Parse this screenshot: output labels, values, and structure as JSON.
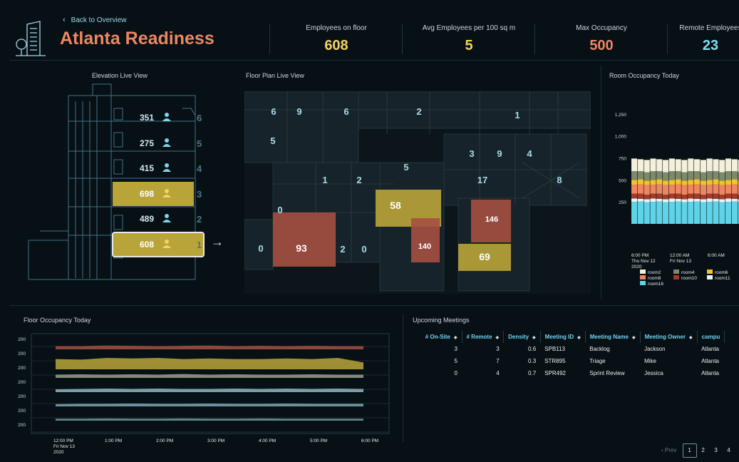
{
  "header": {
    "back_label": "Back to Overview",
    "title": "Atlanta Readiness",
    "kpis": [
      {
        "label": "Employees on floor",
        "value": "608",
        "color": "#f4d35e"
      },
      {
        "label": "Avg Employees per 100 sq m",
        "value": "5",
        "color": "#f4d35e"
      },
      {
        "label": "Max Occupancy",
        "value": "500",
        "color": "#ef8661"
      },
      {
        "label": "Remote Employees",
        "value": "23",
        "color": "#7fe0f0"
      }
    ]
  },
  "elevation": {
    "title": "Elevation Live View",
    "floors": [
      {
        "floor": "6",
        "count": "351",
        "highlight": false
      },
      {
        "floor": "5",
        "count": "275",
        "highlight": false
      },
      {
        "floor": "4",
        "count": "415",
        "highlight": false
      },
      {
        "floor": "3",
        "count": "698",
        "highlight": true
      },
      {
        "floor": "2",
        "count": "489",
        "highlight": false
      },
      {
        "floor": "1",
        "count": "608",
        "highlight": true,
        "selected": true
      }
    ]
  },
  "floorplan": {
    "title": "Floor Plan Live View",
    "rooms": [
      "6",
      "9",
      "6",
      "2",
      "1",
      "5",
      "3",
      "9",
      "4",
      "5",
      "1",
      "2",
      "17",
      "8",
      "0",
      "58",
      "146",
      "0",
      "93",
      "2",
      "0",
      "140",
      "69"
    ]
  },
  "room_occupancy": {
    "title": "Room Occupancy Today",
    "legend": [
      {
        "name": "room2",
        "color": "#f4f0dc"
      },
      {
        "name": "room4",
        "color": "#7c8a6a"
      },
      {
        "name": "room6",
        "color": "#f2c230"
      },
      {
        "name": "room8",
        "color": "#ef8661"
      },
      {
        "name": "room10",
        "color": "#a33b2a"
      },
      {
        "name": "room11",
        "color": "#e6f6f8"
      },
      {
        "name": "room16",
        "color": "#5fd3e8"
      }
    ],
    "x_ticks": [
      {
        "l1": "6:00 PM",
        "l2": "Thu Nov 12",
        "l3": "2020"
      },
      {
        "l1": "12:00 AM",
        "l2": "Fri Nov 13",
        "l3": ""
      },
      {
        "l1": "6:00 AM",
        "l2": "",
        "l3": ""
      }
    ]
  },
  "chart_data": [
    {
      "type": "bar",
      "title": "Room Occupancy Today",
      "ylim": [
        0,
        1250
      ],
      "y_ticks": [
        "250",
        "500",
        "750",
        "1,000",
        "1,250"
      ],
      "stacked": true,
      "bars": 18,
      "series": [
        {
          "name": "room16",
          "values": 250
        },
        {
          "name": "room11",
          "values": 35
        },
        {
          "name": "room10",
          "values": 55
        },
        {
          "name": "room8",
          "values": 105
        },
        {
          "name": "room6",
          "values": 55
        },
        {
          "name": "room4",
          "values": 95
        },
        {
          "name": "room2",
          "values": 140
        }
      ]
    },
    {
      "type": "area",
      "title": "Floor Occupancy Today",
      "y_ticks": [
        "200",
        "200",
        "200",
        "200",
        "200",
        "200",
        "200"
      ],
      "x_ticks": [
        {
          "l1": "12:00 PM",
          "l2": "Fri Nov 13",
          "l3": "2020"
        },
        {
          "l1": "1:00 PM",
          "l2": "",
          "l3": ""
        },
        {
          "l1": "2:00 PM",
          "l2": "",
          "l3": ""
        },
        {
          "l1": "3:00 PM",
          "l2": "",
          "l3": ""
        },
        {
          "l1": "4:00 PM",
          "l2": "",
          "l3": ""
        },
        {
          "l1": "5:00 PM",
          "l2": "",
          "l3": ""
        },
        {
          "l1": "6:00 PM",
          "l2": "",
          "l3": ""
        }
      ],
      "series": [
        {
          "color": "#a55040",
          "values": [
            0.5,
            0.5,
            0.6,
            0.55,
            0.5,
            0.55,
            0.6,
            0.5,
            0.55,
            0.5,
            0.55,
            0.5,
            0.5
          ]
        },
        {
          "color": "#b9a43a",
          "values": [
            0.9,
            0.85,
            1.0,
            0.95,
            1.0,
            0.9,
            0.95,
            0.9,
            0.9,
            0.95,
            0.9,
            1.0,
            0.6
          ]
        },
        {
          "color": "#9a9d8a",
          "values": [
            0.5,
            0.55,
            0.5,
            0.55,
            0.5,
            0.6,
            0.5,
            0.55,
            0.5,
            0.5,
            0.55,
            0.5,
            0.5
          ]
        },
        {
          "color": "#8fb7c0",
          "values": [
            0.45,
            0.5,
            0.55,
            0.5,
            0.55,
            0.5,
            0.5,
            0.55,
            0.5,
            0.55,
            0.5,
            0.55,
            0.5
          ]
        },
        {
          "color": "#7fa8b4",
          "values": [
            0.35,
            0.4,
            0.4,
            0.45,
            0.4,
            0.4,
            0.45,
            0.4,
            0.4,
            0.45,
            0.4,
            0.4,
            0.4
          ]
        },
        {
          "color": "#6e96a2",
          "values": [
            0.3,
            0.3,
            0.35,
            0.3,
            0.3,
            0.35,
            0.3,
            0.3,
            0.35,
            0.3,
            0.3,
            0.3,
            0.3
          ]
        }
      ]
    }
  ],
  "floor_occupancy": {
    "title": "Floor Occupancy Today"
  },
  "meetings": {
    "title": "Upcoming Meetings",
    "columns": [
      "# On-Site",
      "# Remote",
      "Density",
      "Meeting ID",
      "Meeting Name",
      "Meeting Owner",
      "campu"
    ],
    "rows": [
      [
        "3",
        "3",
        "0.6",
        "SPB113",
        "Backlog",
        "Jackson",
        "Atlanta"
      ],
      [
        "5",
        "7",
        "0.3",
        "STR895",
        "Triage",
        "Mike",
        "Atlanta"
      ],
      [
        "0",
        "4",
        "0.7",
        "SPR492",
        "Sprint Review",
        "Jessica",
        "Atlanta"
      ]
    ],
    "pager": {
      "prev": "‹ Prev",
      "pages": [
        "1",
        "2",
        "3",
        "4"
      ],
      "active": "1"
    }
  }
}
